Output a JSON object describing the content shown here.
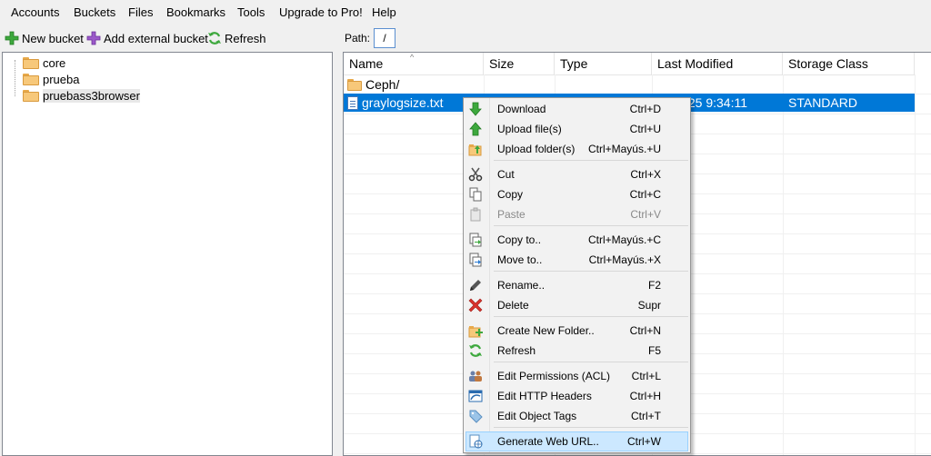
{
  "menubar": {
    "items": [
      "Accounts",
      "Buckets",
      "Files",
      "Bookmarks",
      "Tools",
      "Upgrade to Pro!",
      "Help"
    ]
  },
  "left_toolbar": {
    "new_bucket": "New bucket",
    "add_external_bucket": "Add external bucket",
    "refresh": "Refresh"
  },
  "tree": {
    "buckets": [
      "core",
      "prueba",
      "pruebass3browser"
    ]
  },
  "path_bar": {
    "label": "Path:",
    "value": "/"
  },
  "file_list": {
    "columns": [
      "Name",
      "Size",
      "Type",
      "Last Modified",
      "Storage Class"
    ],
    "rows": [
      {
        "name": "Ceph/",
        "size": "",
        "type": "",
        "modified": "",
        "storage": "",
        "icon": "folder-icon"
      },
      {
        "name": "graylogsize.txt",
        "size": "",
        "type": "",
        "modified": "2025 9:34:11",
        "storage": "STANDARD",
        "icon": "file-icon",
        "selected": true
      }
    ]
  },
  "context_menu": {
    "items": [
      {
        "label": "Download",
        "shortcut": "Ctrl+D",
        "icon": "download-icon"
      },
      {
        "label": "Upload file(s)",
        "shortcut": "Ctrl+U",
        "icon": "upload-icon"
      },
      {
        "label": "Upload folder(s)",
        "shortcut": "Ctrl+Mayús.+U",
        "icon": "upload-folder-icon"
      },
      {
        "label": "Cut",
        "shortcut": "Ctrl+X",
        "icon": "scissors-icon"
      },
      {
        "label": "Copy",
        "shortcut": "Ctrl+C",
        "icon": "copy-icon"
      },
      {
        "label": "Paste",
        "shortcut": "Ctrl+V",
        "icon": "paste-icon",
        "disabled": true
      },
      {
        "label": "Copy to..",
        "shortcut": "Ctrl+Mayús.+C",
        "icon": "copy-to-icon"
      },
      {
        "label": "Move to..",
        "shortcut": "Ctrl+Mayús.+X",
        "icon": "move-to-icon"
      },
      {
        "label": "Rename..",
        "shortcut": "F2",
        "icon": "pencil-icon"
      },
      {
        "label": "Delete",
        "shortcut": "Supr",
        "icon": "delete-icon"
      },
      {
        "label": "Create New Folder..",
        "shortcut": "Ctrl+N",
        "icon": "new-folder-icon"
      },
      {
        "label": "Refresh",
        "shortcut": "F5",
        "icon": "refresh-icon"
      },
      {
        "label": "Edit Permissions (ACL)",
        "shortcut": "Ctrl+L",
        "icon": "permissions-icon"
      },
      {
        "label": "Edit HTTP Headers",
        "shortcut": "Ctrl+H",
        "icon": "http-headers-icon"
      },
      {
        "label": "Edit Object Tags",
        "shortcut": "Ctrl+T",
        "icon": "tag-icon"
      },
      {
        "label": "Generate Web URL..",
        "shortcut": "Ctrl+W",
        "icon": "web-url-icon",
        "highlighted": true
      }
    ]
  },
  "colors": {
    "selection": "#0078d7",
    "menu_hover": "#cce8ff",
    "green_icon": "#3da83d",
    "red_icon": "#d9312b"
  }
}
